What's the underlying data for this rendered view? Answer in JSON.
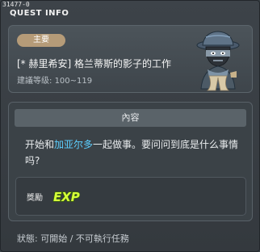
{
  "header": {
    "quest_id": "31477-0",
    "title": "QUEST INFO"
  },
  "quest": {
    "tag": "主要",
    "title": "[* 赫里希安] 格兰蒂斯的影子的工作",
    "level_label": "建議等级:",
    "level_range": "100~119"
  },
  "content": {
    "header": "內容",
    "desc_before": "开始和",
    "desc_highlight": "加亚尔多",
    "desc_after": "一起做事。要问问到底是什么事情吗?",
    "highlight_color": "#5ccfff"
  },
  "reward": {
    "label": "獎勵",
    "exp_text": "EXP"
  },
  "status": {
    "text": "狀態: 可開始 / 不可執行任務"
  }
}
